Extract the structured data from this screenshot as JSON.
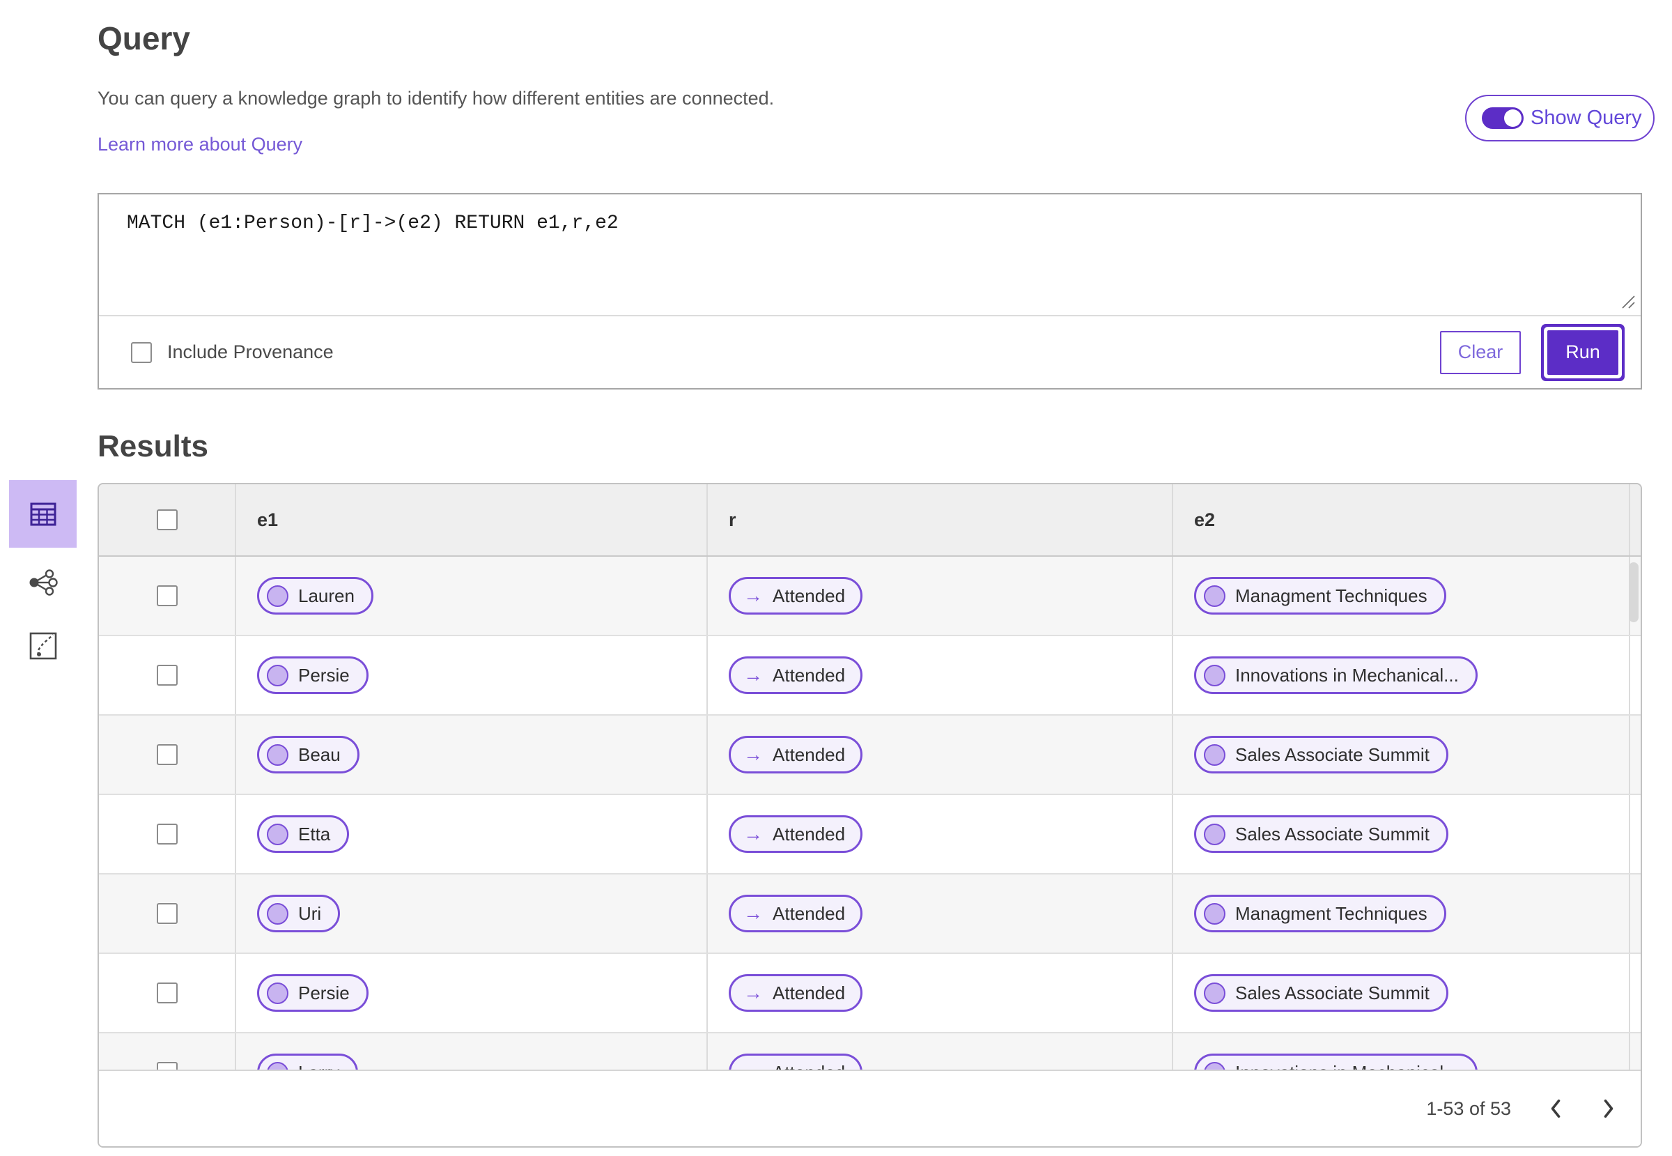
{
  "query_section": {
    "heading": "Query",
    "description": "You can query a knowledge graph to identify how different entities are connected.",
    "learn_more": "Learn more about Query",
    "show_query_label": "Show Query",
    "show_query_on": true,
    "query_text": "MATCH (e1:Person)-[r]->(e2) RETURN e1,r,e2",
    "include_provenance_label": "Include Provenance",
    "include_provenance_checked": false,
    "clear_label": "Clear",
    "run_label": "Run"
  },
  "results_section": {
    "heading": "Results",
    "columns": [
      "e1",
      "r",
      "e2"
    ],
    "rows": [
      {
        "e1": "Lauren",
        "r": "Attended",
        "e2": "Managment Techniques"
      },
      {
        "e1": "Persie",
        "r": "Attended",
        "e2": "Innovations in Mechanical..."
      },
      {
        "e1": "Beau",
        "r": "Attended",
        "e2": "Sales Associate Summit"
      },
      {
        "e1": "Etta",
        "r": "Attended",
        "e2": "Sales Associate Summit"
      },
      {
        "e1": "Uri",
        "r": "Attended",
        "e2": "Managment Techniques"
      },
      {
        "e1": "Persie",
        "r": "Attended",
        "e2": "Sales Associate Summit"
      },
      {
        "e1": "Larry",
        "r": "Attended",
        "e2": "Innovations in Mechanical..."
      }
    ],
    "pagination": {
      "range_text": "1-53 of 53"
    }
  },
  "icons": {
    "arrow_right": "→"
  },
  "colors": {
    "accent": "#5C2DC6",
    "accent_border": "#6F42D0",
    "pill_border": "#7A4ED8",
    "pill_background": "#F4F1FC",
    "node_fill": "#C8B4F0",
    "selected_tile_background": "#CDBAF4",
    "link_text": "#7559D6",
    "header_row_background": "#EFEFEF",
    "alt_row_background": "#F6F6F6"
  }
}
